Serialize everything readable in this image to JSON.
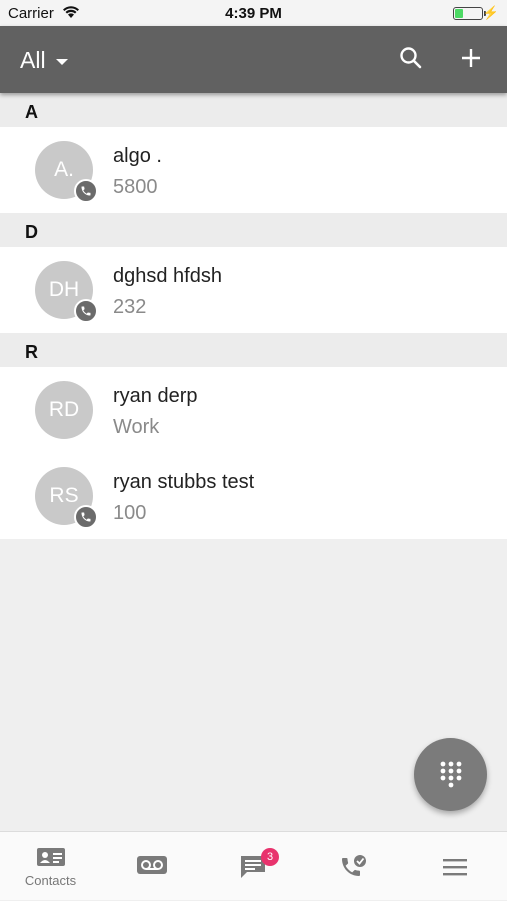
{
  "status_bar": {
    "carrier": "Carrier",
    "time": "4:39 PM"
  },
  "header": {
    "filter_label": "All"
  },
  "sections": [
    {
      "letter": "A",
      "contacts": [
        {
          "initials": "A.",
          "name": "algo .",
          "detail": "5800",
          "has_call_badge": true
        }
      ]
    },
    {
      "letter": "D",
      "contacts": [
        {
          "initials": "DH",
          "name": "dghsd hfdsh",
          "detail": "232",
          "has_call_badge": true
        }
      ]
    },
    {
      "letter": "R",
      "contacts": [
        {
          "initials": "RD",
          "name": "ryan derp",
          "detail": "Work",
          "has_call_badge": false
        },
        {
          "initials": "RS",
          "name": "ryan stubbs test",
          "detail": "100",
          "has_call_badge": true
        }
      ]
    }
  ],
  "tabbar": {
    "contacts_label": "Contacts",
    "messages_badge": "3",
    "icons": [
      "contacts-icon",
      "voicemail-icon",
      "messages-icon",
      "call-history-icon",
      "menu-icon"
    ]
  },
  "colors": {
    "header_bg": "#616161",
    "badge": "#e8336d",
    "avatar": "#c9c9c9"
  }
}
